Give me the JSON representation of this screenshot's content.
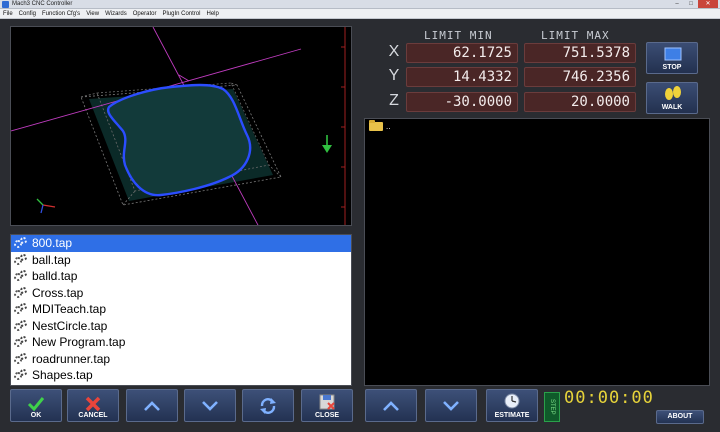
{
  "window": {
    "title": "Mach3 CNC Controller",
    "controls": [
      "–",
      "□",
      "✕"
    ]
  },
  "menu": [
    "File",
    "Config",
    "Function Cfg's",
    "View",
    "Wizards",
    "Operator",
    "PlugIn Control",
    "Help"
  ],
  "limits": {
    "header_min": "LIMIT MIN",
    "header_max": "LIMIT MAX",
    "axes": [
      {
        "axis": "X",
        "min": "62.1725",
        "max": "751.5378"
      },
      {
        "axis": "Y",
        "min": "14.4332",
        "max": "746.2356"
      },
      {
        "axis": "Z",
        "min": "-30.0000",
        "max": "20.0000"
      }
    ]
  },
  "side_buttons": {
    "stop": "STOP",
    "walk": "WALK"
  },
  "browser": {
    "parent_dir": ".."
  },
  "files": [
    {
      "name": "800.tap",
      "selected": true
    },
    {
      "name": "ball.tap",
      "selected": false
    },
    {
      "name": "balld.tap",
      "selected": false
    },
    {
      "name": "Cross.tap",
      "selected": false
    },
    {
      "name": "MDITeach.tap",
      "selected": false
    },
    {
      "name": "NestCircle.tap",
      "selected": false
    },
    {
      "name": "New Program.tap",
      "selected": false
    },
    {
      "name": "roadrunner.tap",
      "selected": false
    },
    {
      "name": "Shapes.tap",
      "selected": false
    }
  ],
  "bottom_buttons": {
    "ok": "OK",
    "cancel": "CANCEL",
    "close": "CLOSE",
    "estimate": "ESTIMATE",
    "about": "ABOUT"
  },
  "step_label": "STEP",
  "timer": "00:00:00",
  "colors": {
    "accent_blue": "#2f6fe6",
    "dro_bg": "#4a2626",
    "timer": "#e6d33a",
    "toolpath": "#2b4dff",
    "grid_magenta": "#c03cc0"
  }
}
